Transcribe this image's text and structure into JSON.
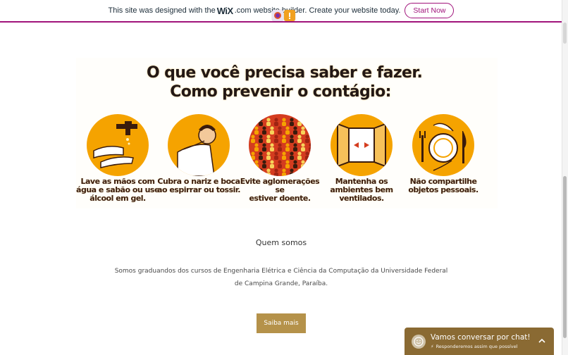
{
  "banner": {
    "text_before": "This site was designed with the",
    "wix_logo": "WiX",
    "dotcom": ".com",
    "text_after": "website builder. Create your website today.",
    "cta_label": "Start Now",
    "accent_color": "#a0137b"
  },
  "extensions": [
    {
      "icon": "firefox-extension-icon"
    },
    {
      "icon": "alert-extension-icon"
    }
  ],
  "infographic": {
    "title_line1": "O que você precisa saber e fazer.",
    "title_line2": "Como prevenir o contágio:",
    "tips": [
      {
        "icon": "handwashing-icon",
        "caption_l1": "Lave as mãos com",
        "caption_l2": "água e sabão ou use",
        "caption_l3": "álcool em gel."
      },
      {
        "icon": "cover-cough-icon",
        "caption_l1": "Cubra o nariz e boca",
        "caption_l2": "ao espirrar ou tossir.",
        "caption_l3": ""
      },
      {
        "icon": "crowd-icon",
        "caption_l1": "Evite aglomerações se",
        "caption_l2": "estiver doente.",
        "caption_l3": ""
      },
      {
        "icon": "open-window-icon",
        "caption_l1": "Mantenha os",
        "caption_l2": "ambientes bem",
        "caption_l3": "ventilados."
      },
      {
        "icon": "plate-cutlery-icon",
        "caption_l1": "Não compartilhe",
        "caption_l2": "objetos pessoais.",
        "caption_l3": ""
      }
    ],
    "disc_color": "#f5a300"
  },
  "about": {
    "heading": "Quem somos",
    "text": "Somos graduandos dos cursos de Engenharia Elétrica e Ciência da Computação da Universidade Federal de Campina Grande, Paraíba.",
    "button_label": "Saiba mais",
    "button_color": "#b5924a"
  },
  "chat": {
    "title": "Vamos conversar por chat!",
    "subtitle": "Responderemos assim que possível",
    "color": "#8a6a33"
  }
}
